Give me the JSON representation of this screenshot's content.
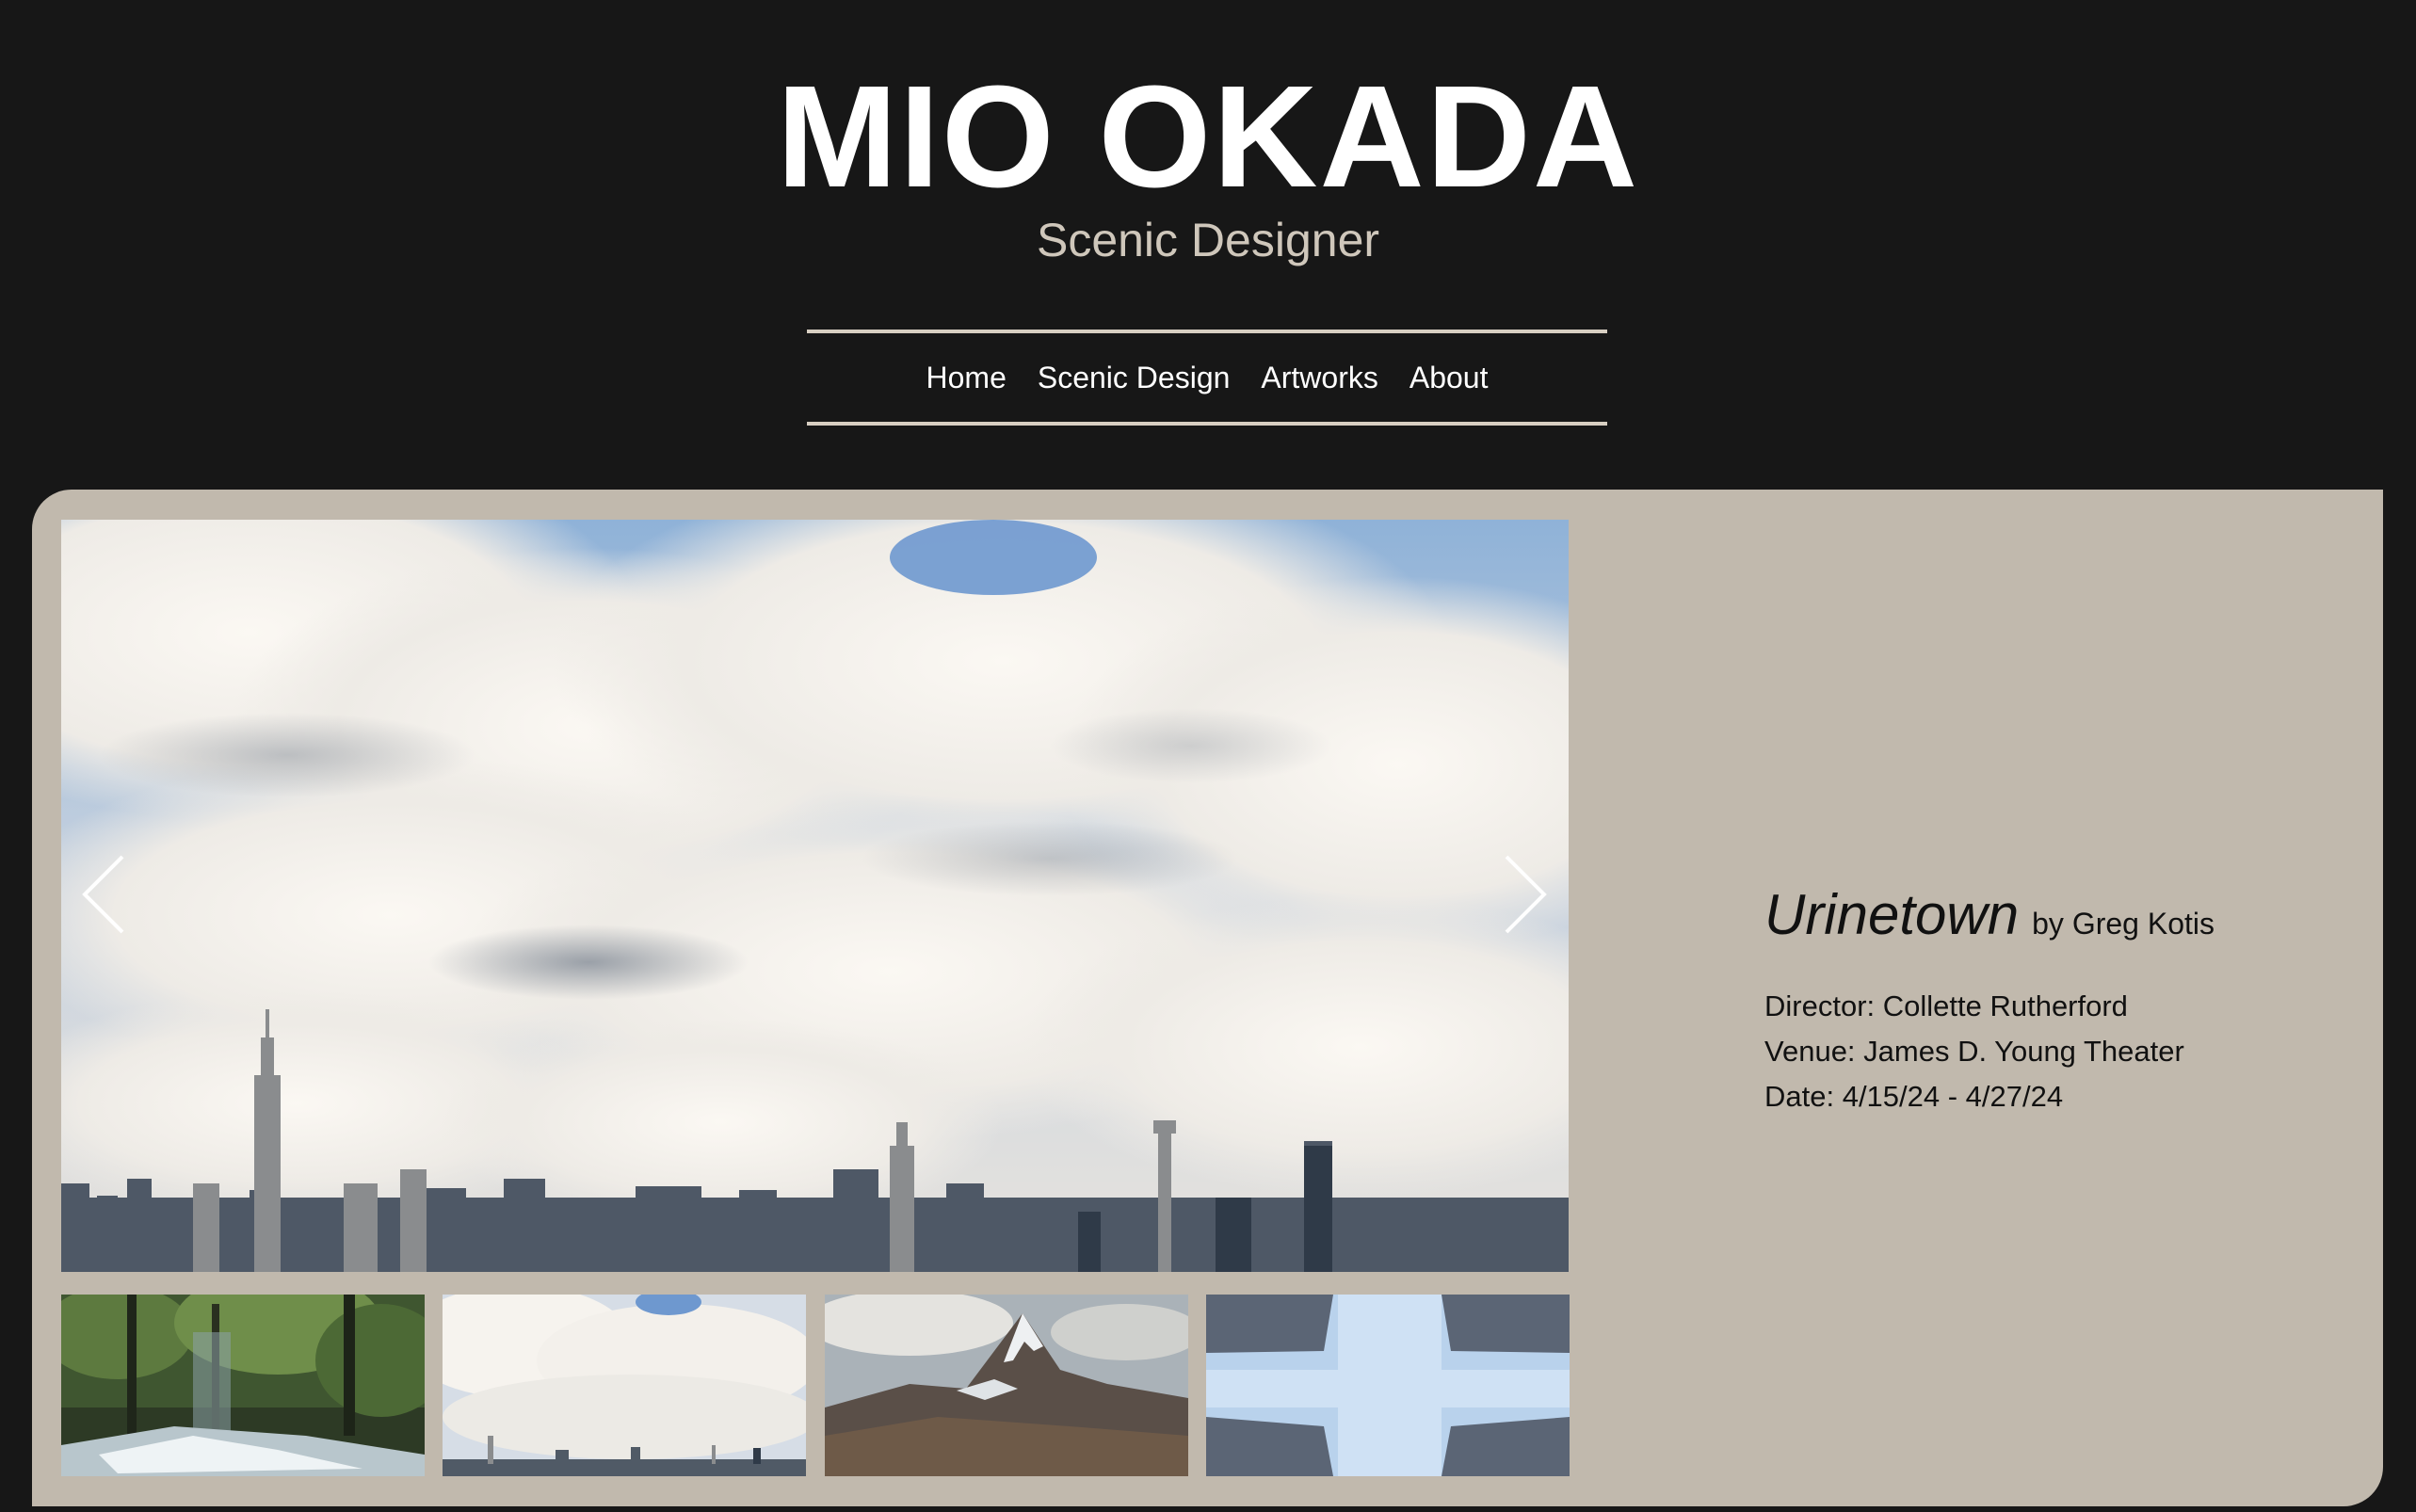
{
  "site": {
    "title": "MIO OKADA",
    "subtitle": "Scenic Designer"
  },
  "nav": {
    "items": [
      {
        "label": "Home"
      },
      {
        "label": "Scenic Design"
      },
      {
        "label": "Artworks"
      },
      {
        "label": "About"
      }
    ]
  },
  "gallery": {
    "main_image": "city-skyline-clouds",
    "prev_icon": "chevron-left-icon",
    "next_icon": "chevron-right-icon",
    "thumbnails": [
      {
        "image": "forest-stream"
      },
      {
        "image": "city-skyline-clouds"
      },
      {
        "image": "mountain-peak"
      },
      {
        "image": "looking-up-buildings"
      }
    ]
  },
  "production": {
    "title": "Urinetown",
    "author": "by Greg Kotis",
    "director": "Director: Collette Rutherford",
    "venue": "Venue: James D. Young Theater",
    "date": "Date: 4/15/24 - 4/27/24"
  },
  "colors": {
    "background": "#171717",
    "panel": "#c1b9ad",
    "accent_line": "#d8cfc2",
    "subtitle": "#cfc7bb"
  }
}
